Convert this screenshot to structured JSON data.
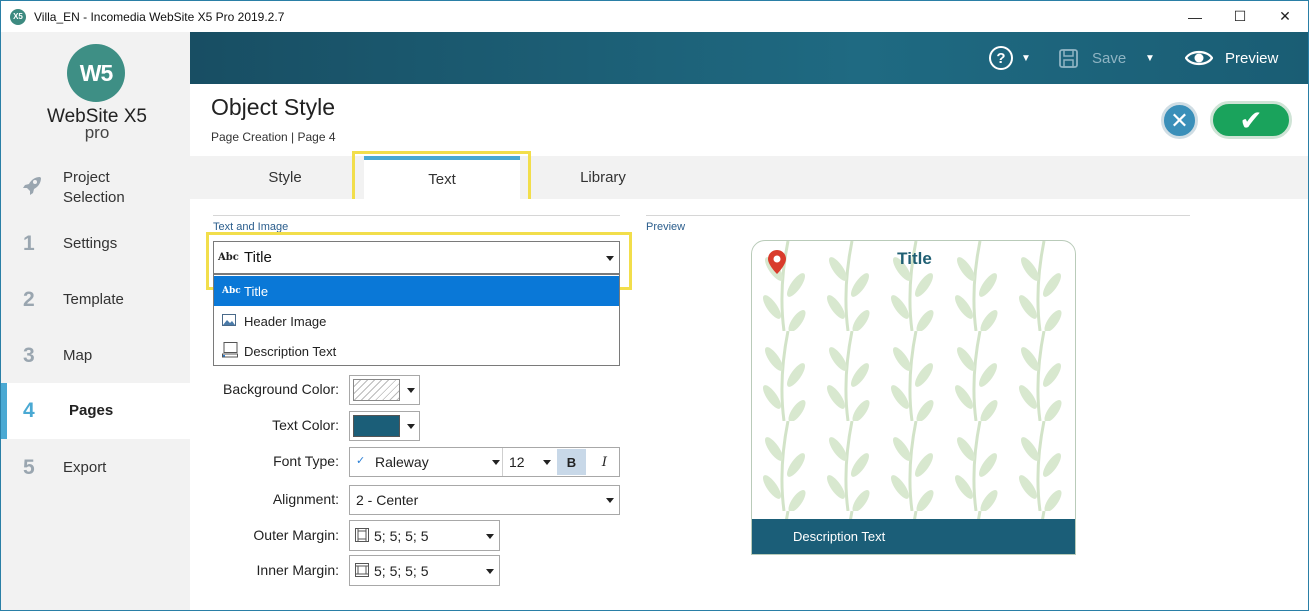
{
  "window": {
    "title": "Villa_EN - Incomedia WebSite X5 Pro 2019.2.7",
    "app_icon": "X5",
    "minimize": "—",
    "maximize": "☐",
    "close": "✕"
  },
  "logo": {
    "mark": "W5",
    "name": "WebSite X5",
    "edition": "pro"
  },
  "sidebar": {
    "items": [
      {
        "num": "",
        "label": "Project Selection",
        "icon": "rocket-icon"
      },
      {
        "num": "1",
        "label": "Settings"
      },
      {
        "num": "2",
        "label": "Template"
      },
      {
        "num": "3",
        "label": "Map"
      },
      {
        "num": "4",
        "label": "Pages",
        "active": true
      },
      {
        "num": "5",
        "label": "Export"
      }
    ]
  },
  "toolbar": {
    "help": "?",
    "save_label": "Save",
    "preview_label": "Preview"
  },
  "header": {
    "title": "Object Style",
    "breadcrumb": "Page Creation | Page 4"
  },
  "tabs": [
    {
      "label": "Style"
    },
    {
      "label": "Text",
      "active": true
    },
    {
      "label": "Library"
    }
  ],
  "text_image": {
    "section_label": "Text and Image",
    "selected": "Title",
    "options": [
      {
        "label": "Title",
        "icon": "abc-icon",
        "selected": true
      },
      {
        "label": "Header Image",
        "icon": "image-icon"
      },
      {
        "label": "Description Text",
        "icon": "description-icon"
      }
    ]
  },
  "form": {
    "background_color_label": "Background Color:",
    "text_color_label": "Text Color:",
    "text_color": "#1b5e78",
    "font_type_label": "Font Type:",
    "font_name": "Raleway",
    "font_size": "12",
    "bold_label": "B",
    "italic_label": "I",
    "alignment_label": "Alignment:",
    "alignment_value": "2 - Center",
    "outer_margin_label": "Outer Margin:",
    "outer_margin_value": "5; 5; 5; 5",
    "inner_margin_label": "Inner Margin:",
    "inner_margin_value": "5; 5; 5; 5"
  },
  "preview": {
    "section_label": "Preview",
    "title": "Title",
    "description": "Description Text"
  },
  "colors": {
    "accent": "#4aa9d3",
    "header_bar": "#1f6a82",
    "ok_button": "#1aa35c",
    "cancel_button": "#3a8fb9",
    "highlight": "#f2de4b"
  }
}
